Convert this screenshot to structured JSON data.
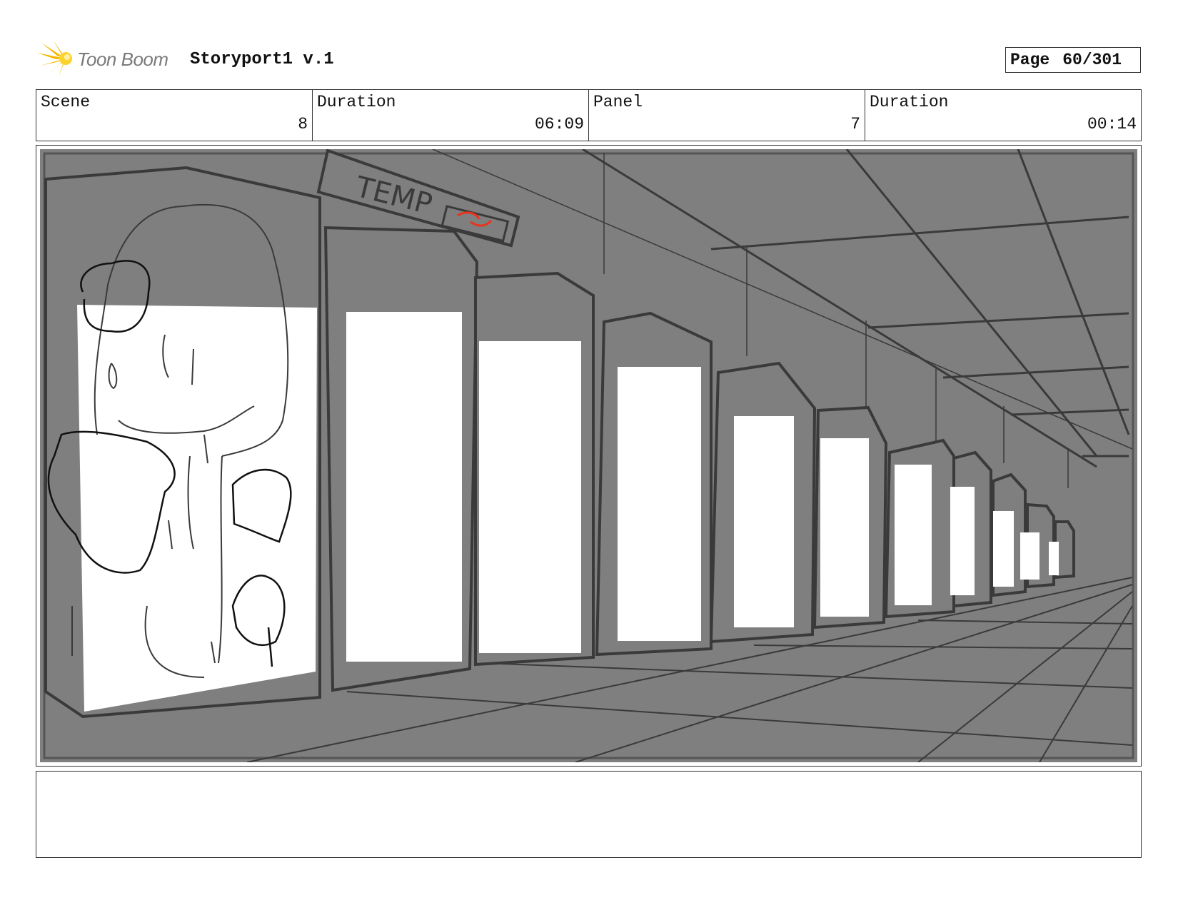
{
  "header": {
    "logo_text": "Toon Boom",
    "project_title": "Storyport1 v.1",
    "page_label": "Page",
    "page_number": "60/301"
  },
  "info": {
    "scene_label": "Scene",
    "scene_value": "8",
    "scene_duration_label": "Duration",
    "scene_duration_value": "06:09",
    "panel_label": "Panel",
    "panel_value": "7",
    "panel_duration_label": "Duration",
    "panel_duration_value": "00:14"
  },
  "panel": {
    "sign_text": "TEMP",
    "background_color": "#7f7f7f",
    "line_color": "#3a3a3a",
    "accent_color": "#e8341c"
  },
  "notes": {
    "text": ""
  }
}
